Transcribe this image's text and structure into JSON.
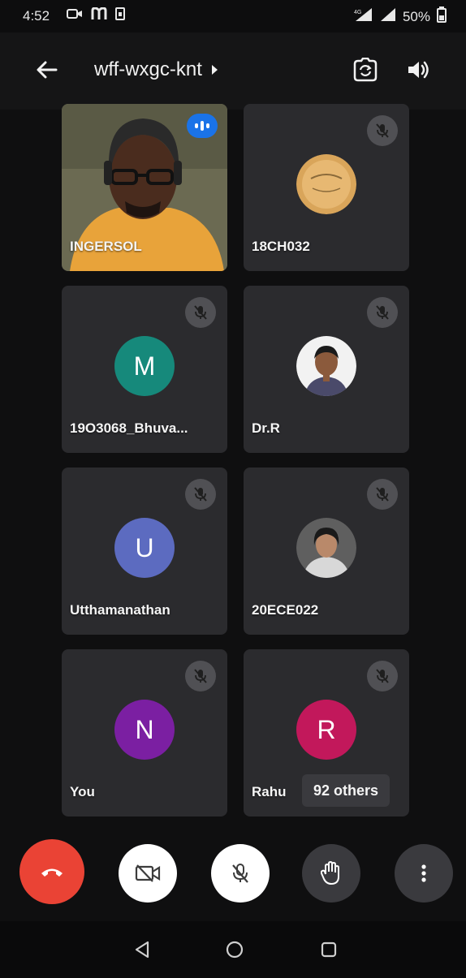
{
  "status_bar": {
    "time": "4:52",
    "battery": "50%",
    "icons": [
      "video-camera-icon",
      "m-app-icon",
      "sim-icon",
      "4g-signal-icon",
      "signal-icon",
      "battery-icon"
    ]
  },
  "header": {
    "meeting_code": "wff-wxgc-knt",
    "icons": [
      "back-arrow-icon",
      "chevron-right-icon",
      "switch-camera-icon",
      "speaker-icon"
    ]
  },
  "participants": [
    {
      "name": "INGERSOL",
      "type": "video",
      "status": "speaking"
    },
    {
      "name": "18CH032",
      "type": "photo",
      "status": "muted"
    },
    {
      "name": "19O3068_Bhuva...",
      "type": "initial",
      "initial": "M",
      "avatar_color": "#16897b",
      "status": "muted"
    },
    {
      "name": "Dr.R",
      "type": "photo",
      "status": "muted"
    },
    {
      "name": "Utthamanathan",
      "type": "initial",
      "initial": "U",
      "avatar_color": "#5c6bc0",
      "status": "muted"
    },
    {
      "name": "20ECE022",
      "type": "photo",
      "status": "muted"
    },
    {
      "name": "You",
      "type": "initial",
      "initial": "N",
      "avatar_color": "#7b1fa2",
      "status": "muted"
    },
    {
      "name": "Rahu",
      "type": "initial",
      "initial": "R",
      "avatar_color": "#c2185b",
      "status": "muted"
    }
  ],
  "others_chip": "92 others",
  "controls": [
    "end-call-button",
    "camera-off-button",
    "mic-off-button",
    "raise-hand-button",
    "more-options-button"
  ],
  "colors": {
    "end_call": "#ea4335",
    "tile_bg": "#2b2b2e",
    "speaking_blue": "#1a73e8"
  },
  "nav_bar": [
    "back-triangle-icon",
    "home-circle-icon",
    "recents-square-icon"
  ]
}
